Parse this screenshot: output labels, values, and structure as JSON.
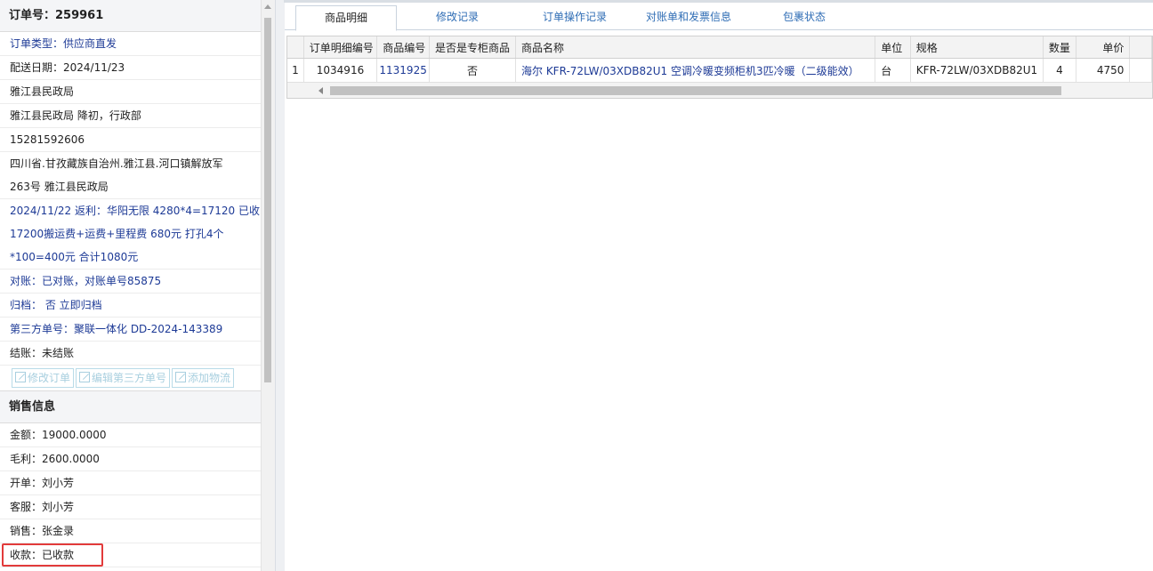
{
  "order": {
    "title": "订单号：259961",
    "order_type": "订单类型：供应商直发",
    "delivery_date": "配送日期：2024/11/23",
    "customer": "雅江县民政局",
    "contact": "雅江县民政局 降初，行政部",
    "phone": "15281592606",
    "address_line1": "四川省.甘孜藏族自治州.雅江县.河口镇解放军",
    "address_line2": "263号 雅江县民政局",
    "rebate_line1": "2024/11/22 返利：华阳无限 4280*4=17120 已收",
    "rebate_line2": "17200搬运费+运费+里程费 680元 打孔4个",
    "rebate_line3": "*100=400元 合计1080元",
    "reconcile": "对账：已对账，对账单号85875",
    "archive": "归档： 否 立即归档",
    "third_party": "第三方单号：聚联一体化 DD-2024-143389",
    "settle": "结账：未结账",
    "buttons": {
      "edit_order": "修改订单",
      "edit_third": "编辑第三方单号",
      "add_logistics": "添加物流"
    }
  },
  "sales": {
    "title": "销售信息",
    "amount": "金额：19000.0000",
    "profit": "毛利：2600.0000",
    "issuer": "开单：刘小芳",
    "service": "客服：刘小芳",
    "seller": "销售：张金录",
    "collection": "收款：已收款"
  },
  "tabs": {
    "items": [
      "商品明细",
      "修改记录",
      "订单操作记录",
      "对账单和发票信息",
      "包裹状态"
    ],
    "active": 0
  },
  "grid": {
    "headers": [
      "订单明细编号",
      "商品编号",
      "是否是专柜商品",
      "商品名称",
      "单位",
      "规格",
      "数量",
      "单价"
    ],
    "rows": [
      {
        "index": "1",
        "detail_no": "1034916",
        "product_no": "1131925",
        "counter": "否",
        "name": "海尔 KFR-72LW/03XDB82U1 空调冷暖变频柜机3匹冷暖（二级能效）",
        "unit": "台",
        "spec": "KFR-72LW/03XDB82U1",
        "qty": "4",
        "price": "4750"
      }
    ]
  },
  "colors": {
    "link_blue": "#1d3a96",
    "tab_blue": "#2f6db5",
    "highlight_red": "#e23b3b",
    "disabled_button": "#a8cfdf"
  }
}
